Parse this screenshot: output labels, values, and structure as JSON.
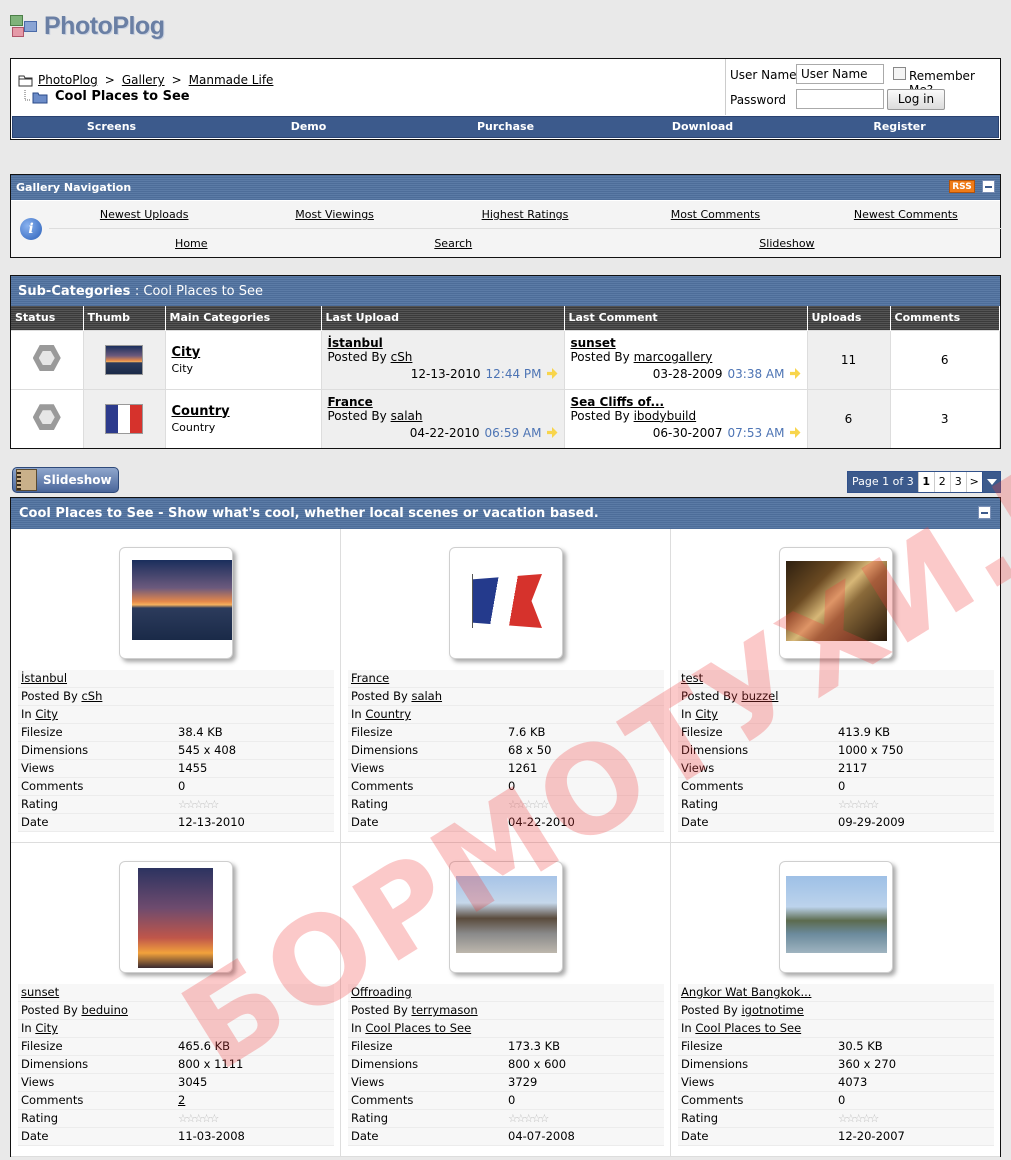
{
  "app": {
    "logo_text": "PhotoPlog"
  },
  "breadcrumb": {
    "items": [
      "PhotoPlog",
      "Gallery",
      "Manmade Life"
    ],
    "separator": ">",
    "current": "Cool Places to See"
  },
  "login": {
    "username_label": "User Name",
    "username_value": "User Name",
    "password_label": "Password",
    "remember_label": "Remember Me?",
    "login_button": "Log in"
  },
  "nav": [
    "Screens",
    "Demo",
    "Purchase",
    "Download",
    "Register"
  ],
  "gallery_nav": {
    "title": "Gallery Navigation",
    "rss_label": "RSS",
    "row1": [
      "Newest Uploads",
      "Most Viewings",
      "Highest Ratings",
      "Most Comments",
      "Newest Comments"
    ],
    "row2": [
      "Home",
      "Search",
      "Slideshow"
    ]
  },
  "subcats": {
    "title": "Sub-Categories",
    "subtitle": ": Cool Places to See",
    "columns": [
      "Status",
      "Thumb",
      "Main Categories",
      "Last Upload",
      "Last Comment",
      "Uploads",
      "Comments"
    ],
    "rows": [
      {
        "name": "City",
        "desc": "City",
        "upload_title": "İstanbul",
        "upload_by_label": "Posted By",
        "upload_by": "cSh",
        "upload_date": "12-13-2010",
        "upload_time": "12:44 PM",
        "comment_title": "sunset",
        "comment_by_label": "Posted By",
        "comment_by": "marcogallery",
        "comment_date": "03-28-2009",
        "comment_time": "03:38 AM",
        "uploads": "11",
        "comments": "6"
      },
      {
        "name": "Country",
        "desc": "Country",
        "upload_title": "France",
        "upload_by_label": "Posted By",
        "upload_by": "salah",
        "upload_date": "04-22-2010",
        "upload_time": "06:59 AM",
        "comment_title": "Sea Cliffs of...",
        "comment_by_label": "Posted By",
        "comment_by": "ibodybuild",
        "comment_date": "06-30-2007",
        "comment_time": "07:53 AM",
        "uploads": "6",
        "comments": "3"
      }
    ]
  },
  "slideshow_button": "Slideshow",
  "pager": {
    "label": "Page 1 of 3",
    "pages": [
      "1",
      "2",
      "3",
      ">"
    ]
  },
  "gallery": {
    "title": "Cool Places to See - Show what's cool, whether local scenes or vacation based.",
    "labels": {
      "posted_by": "Posted By",
      "in": "In",
      "filesize": "Filesize",
      "dimensions": "Dimensions",
      "views": "Views",
      "comments": "Comments",
      "rating": "Rating",
      "date": "Date"
    },
    "items": [
      {
        "title": "İstanbul",
        "author": "cSh",
        "category": "City",
        "filesize": "38.4 KB",
        "dimensions": "545 x 408",
        "views": "1455",
        "comments": "0",
        "date": "12-13-2010",
        "art": "i-ist"
      },
      {
        "title": "France",
        "author": "salah",
        "category": "Country",
        "filesize": "7.6 KB",
        "dimensions": "68 x 50",
        "views": "1261",
        "comments": "0",
        "date": "04-22-2010",
        "art": "i-fr"
      },
      {
        "title": "test",
        "author": "buzzel",
        "category": "City",
        "filesize": "413.9 KB",
        "dimensions": "1000 x 750",
        "views": "2117",
        "comments": "0",
        "date": "09-29-2009",
        "art": "i-test"
      },
      {
        "title": "sunset",
        "author": "beduino",
        "category": "City",
        "filesize": "465.6 KB",
        "dimensions": "800 x 1111",
        "views": "3045",
        "comments": "2",
        "date": "11-03-2008",
        "art": "i-sunset"
      },
      {
        "title": "Offroading",
        "author": "terrymason",
        "category": "Cool Places to See",
        "filesize": "173.3 KB",
        "dimensions": "800 x 600",
        "views": "3729",
        "comments": "0",
        "date": "04-07-2008",
        "art": "i-off"
      },
      {
        "title": "Angkor Wat Bangkok...",
        "author": "igotnotime",
        "category": "Cool Places to See",
        "filesize": "30.5 KB",
        "dimensions": "360 x 270",
        "views": "4073",
        "comments": "0",
        "date": "12-20-2007",
        "art": "i-ang"
      }
    ]
  },
  "watermark": "БОРМОТУХИ.НЕТ",
  "colors": {
    "nav_bar": "#3c5a8c",
    "header_bar": "#4d6d99",
    "time_text": "#4d74b4",
    "rss": "#ef7b18"
  }
}
